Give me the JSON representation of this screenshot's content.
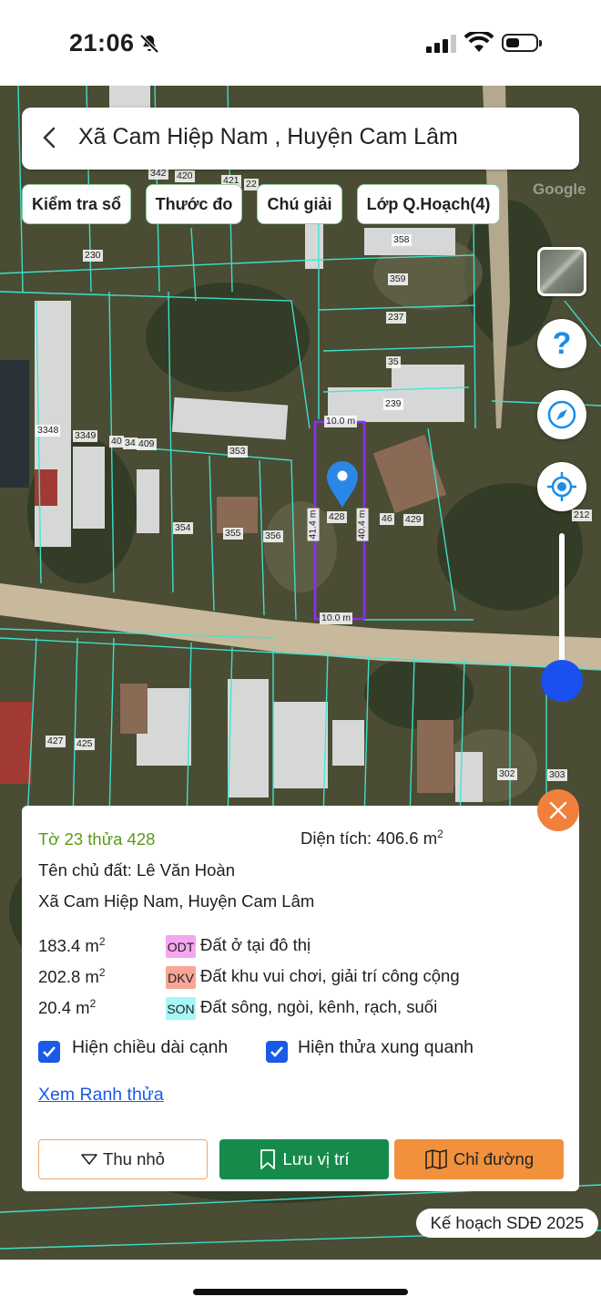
{
  "status": {
    "time": "21:06"
  },
  "header": {
    "title": "Xã Cam Hiệp Nam , Huyện Cam Lâm"
  },
  "toolbar": {
    "chips": [
      "Kiểm tra sổ",
      "Thước đo",
      "Chú giải",
      "Lớp Q.Hoạch(4)"
    ]
  },
  "map": {
    "parcel_labels": [
      "342",
      "420",
      "421",
      "22",
      "230",
      "358",
      "359",
      "237",
      "35",
      "239",
      "3348",
      "3349",
      "40",
      "34",
      "409",
      "353",
      "354",
      "355",
      "356",
      "428",
      "46",
      "429",
      "212",
      "427",
      "425",
      "302",
      "303",
      "Google"
    ],
    "edge_labels": {
      "top": "10.0 m",
      "bottom": "10.0 m",
      "left": "41.4 m",
      "right": "40.4 m"
    },
    "marker_parcel": "428"
  },
  "panel": {
    "parcel": "Tờ 23 thửa 428",
    "area_label": "Diện tích: 406.6 m",
    "area_sup": "2",
    "owner": "Tên chủ đất: Lê Văn Hoàn",
    "address": "Xã Cam Hiệp Nam, Huyện Cam Lâm",
    "land_uses": [
      {
        "area": "183.4 m",
        "sup": "2",
        "code": "ODT",
        "desc": "Đất ở tại đô thị",
        "color": "#f5a6f0"
      },
      {
        "area": "202.8 m",
        "sup": "2",
        "code": "DKV",
        "desc": "Đất khu vui chơi, giải trí công cộng",
        "color": "#f7a696"
      },
      {
        "area": "20.4 m",
        "sup": "2",
        "code": "SON",
        "desc": "Đất sông, ngòi, kênh, rạch, suối",
        "color": "#a8f6f6"
      }
    ],
    "checkbox_edges": "Hiện chiều dài cạnh",
    "checkbox_neighbors": "Hiện thửa xung quanh",
    "link": "Xem Ranh thửa",
    "btn_shrink": "Thu nhỏ",
    "btn_save": "Lưu vị trí",
    "btn_route": "Chỉ đường"
  },
  "plan_badge": "Kế hoạch SDĐ 2025"
}
